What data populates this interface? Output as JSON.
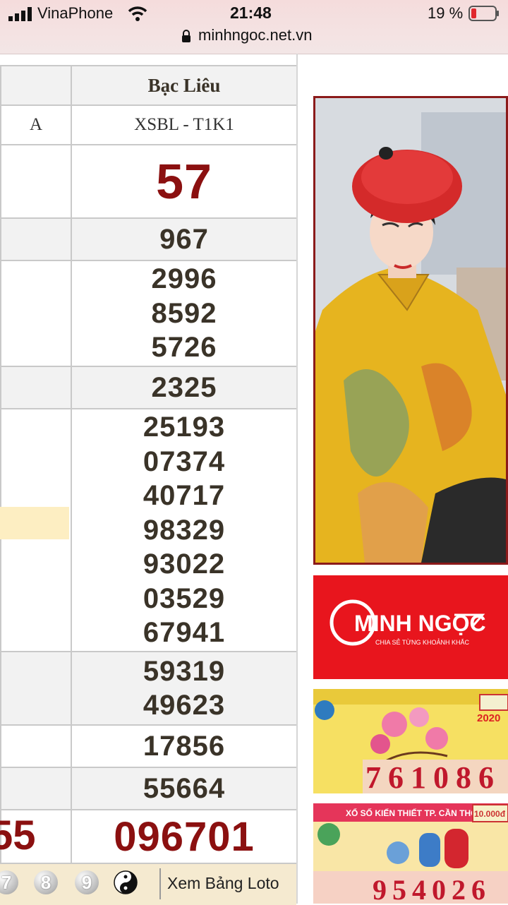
{
  "status_bar": {
    "carrier": "VinaPhone",
    "time": "21:48",
    "battery": "19 %",
    "url": "minhngoc.net.vn"
  },
  "results": {
    "province": "Bạc Liêu",
    "left_code_fragment": "A",
    "code": "XSBL - T1K1",
    "prizes": [
      {
        "numbers": [
          "57"
        ]
      },
      {
        "numbers": [
          "967"
        ]
      },
      {
        "numbers": [
          "2996",
          "8592",
          "5726"
        ]
      },
      {
        "numbers": [
          "2325"
        ]
      },
      {
        "numbers": [
          "25193",
          "07374",
          "40717",
          "98329",
          "93022",
          "03529",
          "67941"
        ]
      },
      {
        "numbers": [
          "59319",
          "49623"
        ]
      },
      {
        "numbers": [
          "17856"
        ]
      },
      {
        "numbers": [
          "55664"
        ]
      },
      {
        "numbers": [
          "096701"
        ]
      }
    ],
    "left_special_fragment": "55"
  },
  "loto_bar": {
    "balls": [
      "7",
      "8",
      "9"
    ],
    "link_label": "Xem Bảng Loto"
  },
  "ads": {
    "brand_name": "MINH NGỌC",
    "brand_tagline": "CHIA SẺ TỪNG KHOẢNH KHẮC",
    "banner1_number": "761086",
    "banner1_year": "2020",
    "banner2_title": "XỔ SỐ KIẾN THIẾT TP. CẦN THƠ",
    "banner2_number": "954026",
    "banner2_prize": "10.000đ"
  },
  "colors": {
    "prize_red": "#8b1010",
    "province_blue": "#1a3ccc",
    "brand_red": "#e8151d"
  }
}
